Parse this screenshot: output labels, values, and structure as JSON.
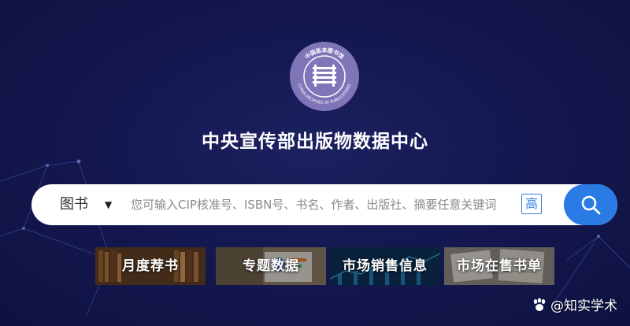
{
  "logo": {
    "text_top": "中国版本图书馆",
    "text_bottom": "CHINA ARCHIVES OF PUBLICATIONS"
  },
  "page_title": "中央宣传部出版物数据中心",
  "search": {
    "category": "图书",
    "placeholder": "您可输入CIP核准号、ISBN号、书名、作者、出版社、摘要任意关键词",
    "advanced_label": "高"
  },
  "tiles": [
    {
      "label": "月度荐书"
    },
    {
      "label": "专题数据"
    },
    {
      "label": "市场销售信息"
    },
    {
      "label": "市场在售书单"
    }
  ],
  "watermark": "@知实学术",
  "colors": {
    "accent": "#2a7be4",
    "background": "#141850",
    "logo": "#7f75b8"
  }
}
